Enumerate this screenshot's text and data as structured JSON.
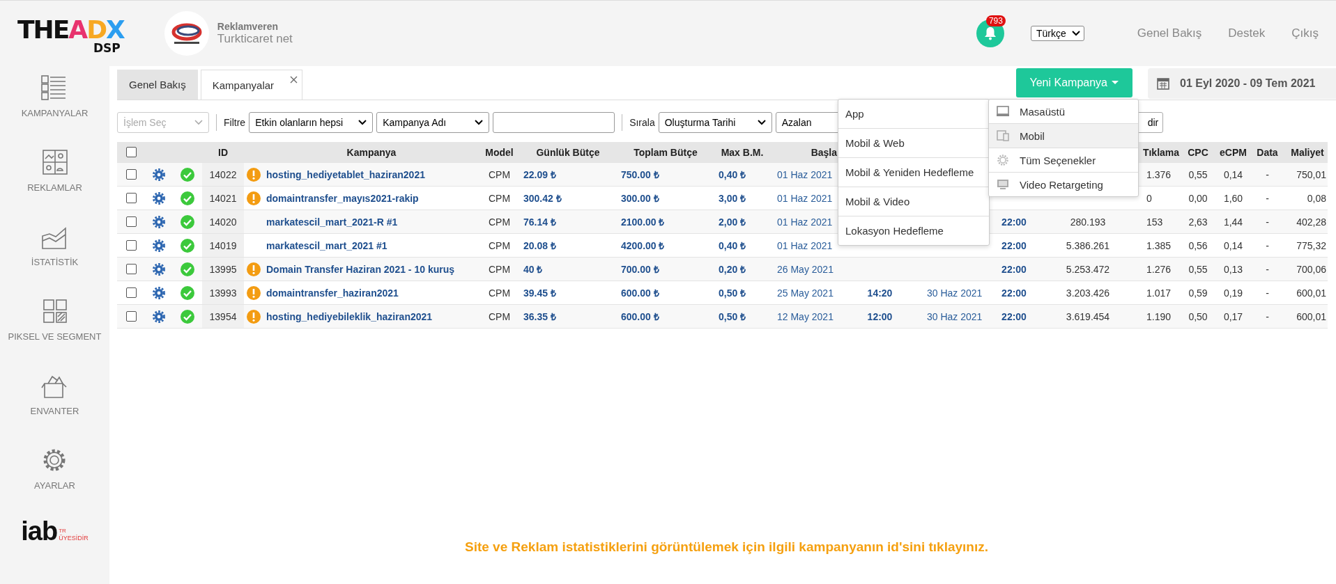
{
  "logo": {
    "parts": [
      {
        "text": "THE",
        "color": "#111111"
      },
      {
        "text": "A",
        "color": "#e8336e"
      },
      {
        "text": "D",
        "color": "#f7a823"
      },
      {
        "text": "X",
        "color": "#2b9ef0"
      }
    ],
    "subtitle": "DSP"
  },
  "advertiser": {
    "role": "Reklamveren",
    "name": "Turkticaret net"
  },
  "notifications": {
    "count": "793"
  },
  "language": {
    "value": "Türkçe"
  },
  "top_links": [
    "Genel Bakış",
    "Destek",
    "Çıkış"
  ],
  "sidebar": {
    "items": [
      {
        "label": "KAMPANYALAR",
        "kind": "campaigns"
      },
      {
        "label": "REKLAMLAR",
        "kind": "ads"
      },
      {
        "label": "İSTATİSTİK",
        "kind": "stats"
      },
      {
        "label": "PIKSEL VE SEGMENT",
        "kind": "pixel"
      },
      {
        "label": "ENVANTER",
        "kind": "inventory"
      },
      {
        "label": "AYARLAR",
        "kind": "settings"
      }
    ],
    "badge": {
      "text": "iab",
      "tag": "TR",
      "caption": "ÜYESİDİR"
    }
  },
  "tabs": [
    {
      "label": "Genel Bakış",
      "selected": false,
      "closable": false
    },
    {
      "label": "Kampanyalar",
      "selected": true,
      "closable": true
    }
  ],
  "new_campaign_button": "Yeni Kampanya",
  "date_range": "01 Eyl 2020 - 09 Tem 2021",
  "toolbar": {
    "action_select": {
      "placeholder": "İşlem Seç"
    },
    "filter_label": "Filtre",
    "filter_value": "Etkin olanların hepsi",
    "field_value": "Kampanya Adı",
    "sort_label": "Sırala",
    "sort_value": "Oluşturma Tarihi",
    "order_value": "Azalan",
    "button": "dir"
  },
  "table": {
    "header_checked": false,
    "columns": [
      "ID",
      "Kampanya",
      "Model",
      "Günlük Bütçe",
      "Toplam Bütçe",
      "Max B.M.",
      "Başla",
      "Tıklama",
      "CPC",
      "eCPM",
      "Data",
      "Maliyet"
    ],
    "rows": [
      {
        "checked": false,
        "active": true,
        "warning": true,
        "id": "14022",
        "name": "hosting_hediyetablet_haziran2021",
        "model": "CPM",
        "daily_budget": "22.09 ₺",
        "total_budget": "750.00 ₺",
        "max_bid": "0,40 ₺",
        "start_date": "01 Haz 2021",
        "clicks": "1.376",
        "cpc": "0,55",
        "ecpm": "0,14",
        "data": "-",
        "cost": "750,01"
      },
      {
        "checked": false,
        "active": true,
        "warning": true,
        "id": "14021",
        "name": "domaintransfer_mayıs2021-rakip",
        "model": "CPM",
        "daily_budget": "300.42 ₺",
        "total_budget": "300.00 ₺",
        "max_bid": "3,00 ₺",
        "start_date": "01 Haz 2021",
        "clicks": "0",
        "cpc": "0,00",
        "ecpm": "1,60",
        "data": "-",
        "cost": "0,08"
      },
      {
        "checked": false,
        "active": true,
        "warning": false,
        "id": "14020",
        "name": "markatescil_mart_2021-R #1",
        "model": "CPM",
        "daily_budget": "76.14 ₺",
        "total_budget": "2100.00 ₺",
        "max_bid": "2,00 ₺",
        "start_date": "01 Haz 2021",
        "end_time": "22:00",
        "impressions": "280.193",
        "clicks": "153",
        "cpc": "2,63",
        "ecpm": "1,44",
        "data": "-",
        "cost": "402,28"
      },
      {
        "checked": false,
        "active": true,
        "warning": false,
        "id": "14019",
        "name": "markatescil_mart_2021 #1",
        "model": "CPM",
        "daily_budget": "20.08 ₺",
        "total_budget": "4200.00 ₺",
        "max_bid": "0,40 ₺",
        "start_date": "01 Haz 2021",
        "end_time": "22:00",
        "impressions": "5.386.261",
        "clicks": "1.385",
        "cpc": "0,56",
        "ecpm": "0,14",
        "data": "-",
        "cost": "775,32"
      },
      {
        "checked": false,
        "active": true,
        "warning": true,
        "id": "13995",
        "name": "Domain Transfer Haziran 2021 - 10 kuruş",
        "model": "CPM",
        "daily_budget": "40 ₺",
        "total_budget": "700.00 ₺",
        "max_bid": "0,20 ₺",
        "start_date": "26 May 2021",
        "end_time": "22:00",
        "impressions": "5.253.472",
        "clicks": "1.276",
        "cpc": "0,55",
        "ecpm": "0,13",
        "data": "-",
        "cost": "700,06"
      },
      {
        "checked": false,
        "active": true,
        "warning": true,
        "id": "13993",
        "name": "domaintransfer_haziran2021",
        "model": "CPM",
        "daily_budget": "39.45 ₺",
        "total_budget": "600.00 ₺",
        "max_bid": "0,50 ₺",
        "start_date": "25 May 2021",
        "start_time": "14:20",
        "end_date": "30 Haz 2021",
        "end_time": "22:00",
        "impressions": "3.203.426",
        "clicks": "1.017",
        "cpc": "0,59",
        "ecpm": "0,19",
        "data": "-",
        "cost": "600,01"
      },
      {
        "checked": false,
        "active": true,
        "warning": true,
        "id": "13954",
        "name": "hosting_hediyebileklik_haziran2021",
        "model": "CPM",
        "daily_budget": "36.35 ₺",
        "total_budget": "600.00 ₺",
        "max_bid": "0,50 ₺",
        "start_date": "12 May 2021",
        "start_time": "12:00",
        "end_date": "30 Haz 2021",
        "end_time": "22:00",
        "impressions": "3.619.454",
        "clicks": "1.190",
        "cpc": "0,50",
        "ecpm": "0,17",
        "data": "-",
        "cost": "600,01"
      }
    ]
  },
  "campaign_menu": {
    "items": [
      "App",
      "Mobil & Web",
      "Mobil & Yeniden Hedefleme",
      "Mobil & Video",
      "Lokasyon Hedefleme"
    ]
  },
  "campaign_submenu": {
    "items": [
      {
        "label": "Masaüstü",
        "kind": "desktop",
        "selected": false
      },
      {
        "label": "Mobil",
        "kind": "mobile",
        "selected": true
      },
      {
        "label": "Tüm Seçenekler",
        "kind": "all",
        "selected": false
      },
      {
        "label": "Video Retargeting",
        "kind": "video",
        "selected": false
      }
    ]
  },
  "footer_message": "Site ve Reklam istatistiklerini görüntülemek için ilgili kampanyanın id'sini tıklayınız."
}
